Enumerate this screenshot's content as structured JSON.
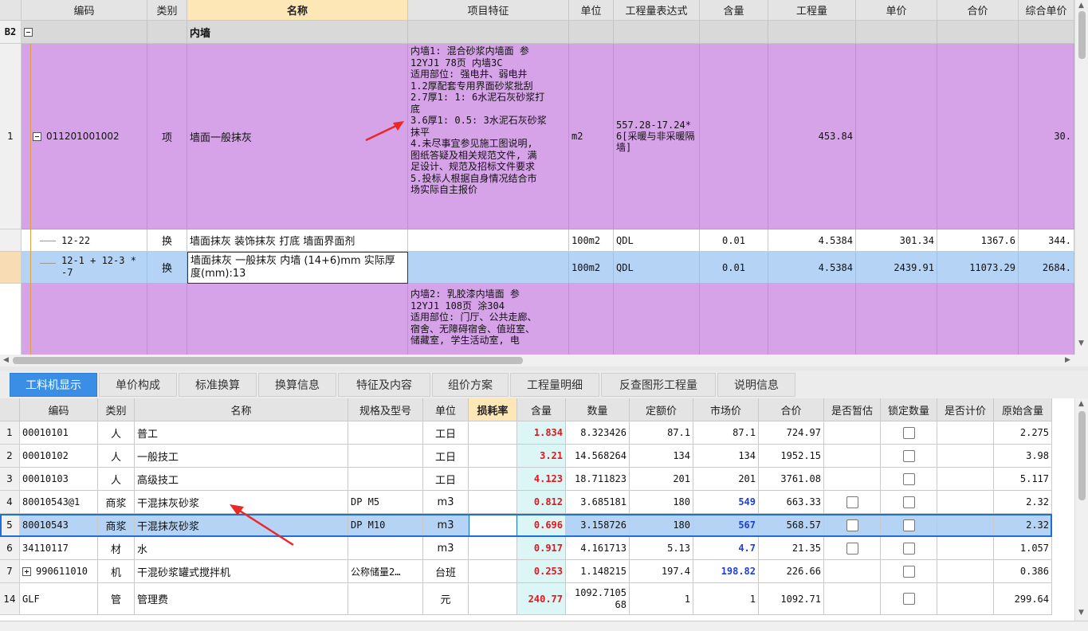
{
  "top_grid": {
    "headers": [
      "编码",
      "类别",
      "名称",
      "项目特征",
      "单位",
      "工程量表达式",
      "含量",
      "工程量",
      "单价",
      "合价",
      "综合单价"
    ],
    "section": {
      "rowno": "B2",
      "name": "内墙"
    },
    "item": {
      "rowno": "1",
      "code": "011201001002",
      "type": "项",
      "name": "墙面一般抹灰",
      "feature_lines": [
        "内墙1: 混合砂浆内墙面 参",
        "12YJ1 78页 内墙3C",
        "适用部位: 强电井、弱电井",
        "1.2厚配套专用界面砂浆批刮",
        "2.7厚1: 1: 6水泥石灰砂浆打",
        "底",
        "3.6厚1: 0.5: 3水泥石灰砂浆",
        "抹平",
        "4.未尽事宜参见施工图说明,",
        "图纸答疑及相关规范文件, 满",
        "足设计、规范及招标文件要求",
        "5.投标人根据自身情况结合市",
        "场实际自主报价"
      ],
      "unit": "m2",
      "expr": "557.28-17.24*6[采暖与非采暖隔墙]",
      "qty": "453.84",
      "composite": "30."
    },
    "sub1": {
      "code": "12-22",
      "type": "换",
      "name": "墙面抹灰 装饰抹灰 打底 墙面界面剂",
      "unit": "100m2",
      "expr": "QDL",
      "content": "0.01",
      "qty": "4.5384",
      "price": "301.34",
      "total": "1367.6",
      "composite": "344."
    },
    "sub2": {
      "code": "12-1 + 12-3 * -7",
      "type": "换",
      "name": "墙面抹灰 一般抹灰 内墙 (14+6)mm 实际厚度(mm):13",
      "unit": "100m2",
      "expr": "QDL",
      "content": "0.01",
      "qty": "4.5384",
      "price": "2439.91",
      "total": "11073.29",
      "composite": "2684."
    },
    "next_feature_lines": [
      "内墙2: 乳胶漆内墙面 参",
      "12YJ1 108页 涂304",
      "适用部位: 门厅、公共走廊、",
      "宿舍、无障碍宿舍、值班室、",
      "储藏室, 学生活动室, 电"
    ]
  },
  "tabs": [
    "工料机显示",
    "单价构成",
    "标准换算",
    "换算信息",
    "特征及内容",
    "组价方案",
    "工程量明细",
    "反查图形工程量",
    "说明信息"
  ],
  "bottom_grid": {
    "headers": [
      "编码",
      "类别",
      "名称",
      "规格及型号",
      "单位",
      "损耗率",
      "含量",
      "数量",
      "定额价",
      "市场价",
      "合价",
      "是否暂估",
      "锁定数量",
      "是否计价",
      "原始含量"
    ],
    "rows": [
      {
        "no": "1",
        "code": "00010101",
        "type": "人",
        "name": "普工",
        "spec": "",
        "unit": "工日",
        "loss": "",
        "content": "1.834",
        "qty": "8.323426",
        "quota": "87.1",
        "market": "87.1",
        "total": "724.97",
        "orig": "2.275"
      },
      {
        "no": "2",
        "code": "00010102",
        "type": "人",
        "name": "一般技工",
        "spec": "",
        "unit": "工日",
        "loss": "",
        "content": "3.21",
        "qty": "14.568264",
        "quota": "134",
        "market": "134",
        "total": "1952.15",
        "orig": "3.98"
      },
      {
        "no": "3",
        "code": "00010103",
        "type": "人",
        "name": "高级技工",
        "spec": "",
        "unit": "工日",
        "loss": "",
        "content": "4.123",
        "qty": "18.711823",
        "quota": "201",
        "market": "201",
        "total": "3761.08",
        "orig": "5.117"
      },
      {
        "no": "4",
        "code": "80010543@1",
        "type": "商浆",
        "name": "干混抹灰砂浆",
        "spec": "DP M5",
        "unit": "m3",
        "loss": "",
        "content": "0.812",
        "qty": "3.685181",
        "quota": "180",
        "market": "549",
        "total": "663.33",
        "orig": "2.32"
      },
      {
        "no": "5",
        "code": "80010543",
        "type": "商浆",
        "name": "干混抹灰砂浆",
        "spec": "DP M10",
        "unit": "m3",
        "loss": "",
        "content": "0.696",
        "qty": "3.158726",
        "quota": "180",
        "market": "567",
        "total": "568.57",
        "orig": "2.32"
      },
      {
        "no": "6",
        "code": "34110117",
        "type": "材",
        "name": "水",
        "spec": "",
        "unit": "m3",
        "loss": "",
        "content": "0.917",
        "qty": "4.161713",
        "quota": "5.13",
        "market": "4.7",
        "total": "21.35",
        "orig": "1.057"
      },
      {
        "no": "7",
        "code": "990611010",
        "type": "机",
        "name": "干混砂浆罐式搅拌机",
        "spec": "公称储量2…",
        "unit": "台班",
        "loss": "",
        "content": "0.253",
        "qty": "1.148215",
        "quota": "197.4",
        "market": "198.82",
        "total": "226.66",
        "orig": "0.386"
      },
      {
        "no": "14",
        "code": "GLF",
        "type": "管",
        "name": "管理费",
        "spec": "",
        "unit": "元",
        "loss": "",
        "content": "240.77",
        "qty": "1092.7105 68",
        "quota": "1",
        "market": "1",
        "total": "1092.71",
        "orig": "299.64"
      }
    ]
  },
  "colors": {
    "purple": "#d6a3e8",
    "selected_blue": "#b5d3f4",
    "tab_active": "#3a8ee6",
    "red_value": "#e0181e",
    "blue_value": "#1d3fd6"
  }
}
